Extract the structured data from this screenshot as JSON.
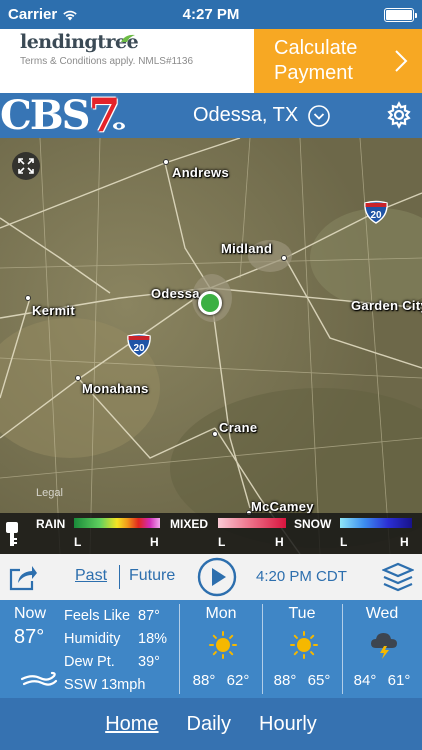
{
  "status": {
    "carrier": "Carrier",
    "time": "4:27 PM"
  },
  "ad": {
    "brand": "lendingtree",
    "terms": "Terms & Conditions apply. NMLS#1136",
    "cta": "Calculate Payment",
    "cta_color": "#f7a823"
  },
  "header": {
    "logo_text": "CBS",
    "logo_number": "7",
    "location": "Odessa, TX",
    "bg_color": "#3775b5"
  },
  "map": {
    "cities": [
      "Andrews",
      "Midland",
      "Odessa",
      "Kermit",
      "Garden City",
      "Monahans",
      "Crane",
      "McCamey"
    ],
    "highway_label": "20",
    "legal": "Legal"
  },
  "legend": {
    "rain": "RAIN",
    "mixed": "MIXED",
    "snow": "SNOW",
    "low": "L",
    "high": "H"
  },
  "timeline": {
    "past": "Past",
    "future": "Future",
    "timestamp": "4:20 PM CDT"
  },
  "current": {
    "label": "Now",
    "temp": "87°",
    "feels_like_label": "Feels Like",
    "feels_like": "87°",
    "humidity_label": "Humidity",
    "humidity": "18%",
    "dewpoint_label": "Dew Pt.",
    "dewpoint": "39°",
    "wind": "SSW 13mph"
  },
  "forecast": [
    {
      "day": "Mon",
      "icon": "sun-icon",
      "high": "88°",
      "low": "62°"
    },
    {
      "day": "Tue",
      "icon": "sun-icon",
      "high": "88°",
      "low": "65°"
    },
    {
      "day": "Wed",
      "icon": "thunderstorm-icon",
      "high": "84°",
      "low": "61°"
    }
  ],
  "nav": {
    "home": "Home",
    "daily": "Daily",
    "hourly": "Hourly"
  }
}
